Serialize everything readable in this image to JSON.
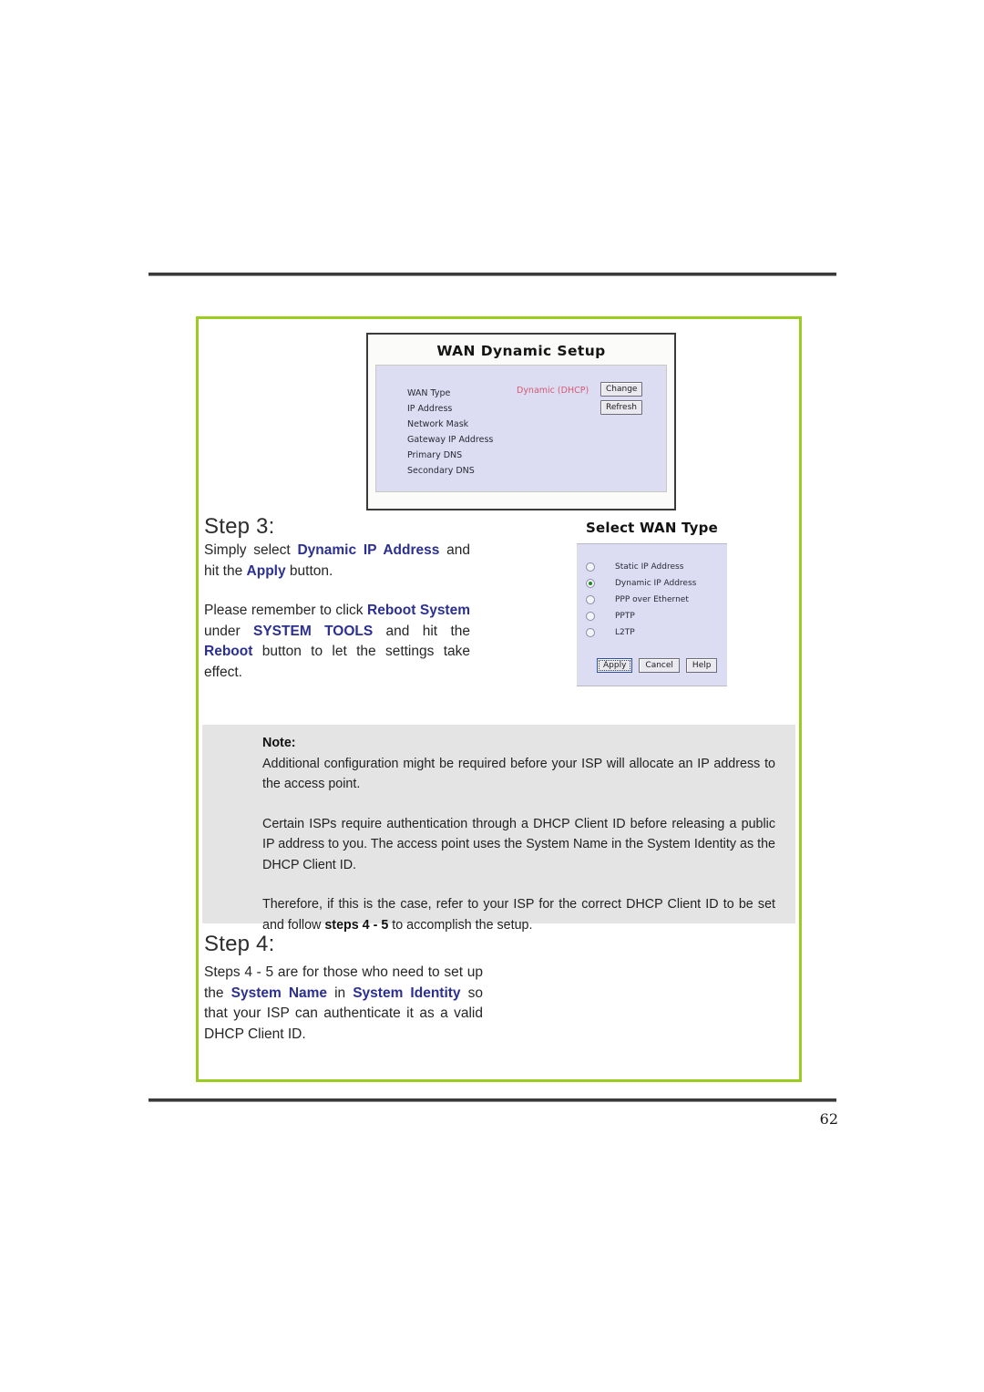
{
  "page": {
    "number": "62"
  },
  "wan_dynamic_setup": {
    "title": "WAN Dynamic Setup",
    "rows": [
      "WAN Type",
      "IP Address",
      "Network Mask",
      "Gateway IP Address",
      "Primary DNS",
      "Secondary DNS"
    ],
    "wan_type_value": "Dynamic (DHCP)",
    "value_color": "#d45a72",
    "buttons": {
      "change": "Change",
      "refresh": "Refresh"
    }
  },
  "select_wan_type": {
    "title": "Select WAN Type",
    "options": [
      {
        "label": "Static IP Address",
        "selected": false
      },
      {
        "label": "Dynamic IP Address",
        "selected": true
      },
      {
        "label": "PPP over Ethernet",
        "selected": false
      },
      {
        "label": "PPTP",
        "selected": false
      },
      {
        "label": "L2TP",
        "selected": false
      }
    ],
    "buttons": {
      "apply": "Apply",
      "cancel": "Cancel",
      "help": "Help"
    }
  },
  "step3": {
    "heading": "Step 3:",
    "para1": {
      "a": "Simply select ",
      "b1": "Dynamic IP Address",
      "c": " and hit the ",
      "b2": "Apply",
      "d": " button."
    },
    "para2": {
      "a": "Please remember to click ",
      "b1": "Reboot System",
      "c": " under ",
      "b2": "SYSTEM TOOLS",
      "d": " and hit the ",
      "b3": "Reboot",
      "e": " button to let the settings take effect."
    }
  },
  "note": {
    "title": "Note:",
    "para1": "Additional configuration might be required before your ISP will allocate an IP address to the access point.",
    "para2": "Certain ISPs require authentication through a DHCP Client ID before releasing a public IP address to you. The access point uses the System Name in the System Identity as the DHCP Client ID.",
    "para3": {
      "a": "Therefore, if this is the case, refer to your ISP for the correct DHCP Client ID to be set and follow ",
      "b": "steps 4 - 5",
      "c": " to accomplish the setup."
    }
  },
  "step4": {
    "heading": "Step 4:",
    "para1": {
      "a": "Steps 4 - 5 are for those who need to set up the ",
      "b1": "System Name",
      "c": " in ",
      "b2": "System Identity",
      "d": " so that your ISP can authenticate it as a valid DHCP Client ID."
    }
  },
  "colors": {
    "accent_green": "#9ACD1E",
    "link_blue": "#2b2f8f",
    "note_bg": "#e4e4e4"
  }
}
